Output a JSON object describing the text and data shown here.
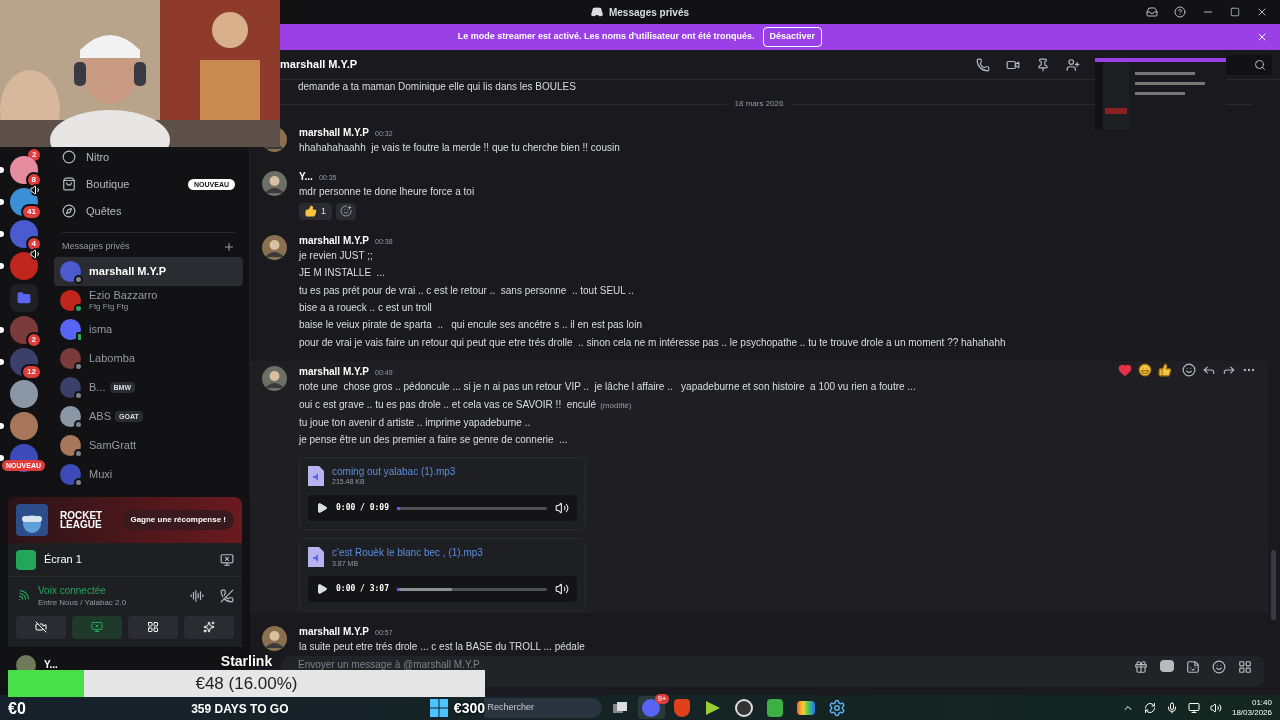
{
  "titlebar": {
    "title": "Messages privés"
  },
  "banner": {
    "text": "Le mode streamer est activé. Les noms d'utilisateur ont été tronqués.",
    "button": "Désactiver"
  },
  "servers": [
    {
      "kind": "badge",
      "badge": "2"
    },
    {
      "kind": "server",
      "badge": "8",
      "unread": true,
      "speaker": false
    },
    {
      "kind": "server",
      "badge": "41",
      "unread": true,
      "speaker": true
    },
    {
      "kind": "server",
      "badge": "4",
      "unread": true,
      "speaker": false
    },
    {
      "kind": "server",
      "unread": true,
      "speaker": true
    },
    {
      "kind": "folder",
      "unread": false,
      "speaker": false
    },
    {
      "kind": "server",
      "badge": "2",
      "unread": true,
      "speaker": false
    },
    {
      "kind": "server",
      "badge": "12",
      "unread": true,
      "speaker": false
    },
    {
      "kind": "server",
      "unread": false,
      "speaker": false
    },
    {
      "kind": "server",
      "unread": true,
      "speaker": false
    },
    {
      "kind": "server",
      "label": "NOUVEAU",
      "unread": true,
      "speaker": false
    }
  ],
  "nav": [
    {
      "kind": "nitro",
      "label": "Nitro"
    },
    {
      "kind": "shop",
      "label": "Boutique",
      "badge": "NOUVEAU"
    },
    {
      "kind": "quests",
      "label": "Quêtes"
    }
  ],
  "dm_section": {
    "title": "Messages privés"
  },
  "dms": [
    {
      "name": "marshall M.Y.P",
      "selected": true,
      "online": false,
      "mobile": false
    },
    {
      "name": "Ezio Bazzarro",
      "selected": false,
      "online": true,
      "mobile": false,
      "activity": "Ftg Ftg Ftg"
    },
    {
      "name": "isma",
      "selected": false,
      "online": true,
      "mobile": true
    },
    {
      "name": "Labomba",
      "selected": false,
      "online": false,
      "mobile": false
    },
    {
      "name": "B...",
      "selected": false,
      "online": false,
      "mobile": false,
      "tag": "BMW"
    },
    {
      "name": "ABS",
      "selected": false,
      "online": false,
      "mobile": false,
      "tag": "GOAT"
    },
    {
      "name": "SamGratt",
      "selected": false,
      "online": false,
      "mobile": false
    },
    {
      "name": "Muxi",
      "selected": false,
      "online": false,
      "mobile": false
    }
  ],
  "promo": {
    "title": "ROCKET LEAGUE",
    "button": "Gagne une récompense !"
  },
  "screen_share": {
    "title": "Écran 1"
  },
  "voice": {
    "status": "Voix connectée",
    "channel": "Entre Nous / Yalabac 2.0"
  },
  "voice_buttons": [
    {
      "kind": "camera-off",
      "selected": false
    },
    {
      "kind": "screen",
      "selected": true
    },
    {
      "kind": "activities",
      "selected": false
    },
    {
      "kind": "soundboard",
      "selected": false
    }
  ],
  "user": {
    "name": "Y..."
  },
  "chat_header": {
    "name": "marshall M.Y.P"
  },
  "messages": [
    {
      "kind": "text",
      "lines": [
        "demande a ta maman Dominique elle qui lis dans les BOULES"
      ]
    },
    {
      "kind": "divider",
      "text": "18 mars 2026"
    },
    {
      "kind": "message",
      "author": "marshall M.Y.P",
      "time": "00:32",
      "hovered": false,
      "lines": [
        "hhahahahaahh  je vais te foutre la merde !! que tu cherche bien !! cousin"
      ]
    },
    {
      "kind": "message",
      "author": "Y...",
      "time": "00:35",
      "hovered": false,
      "lines": [
        "mdr personne te done lheure force a toi"
      ],
      "reactions": [
        {
          "count": "1"
        }
      ]
    },
    {
      "kind": "message",
      "author": "marshall M.Y.P",
      "time": "00:38",
      "hovered": false,
      "lines": [
        "je revien JUST ;;",
        "JE M INSTALLE  ...",
        "tu es pas prét pour de vrai .. c est le retour ..  sans personne  .. tout SEUL ..",
        "bise a a roueck .. c est un troll",
        "baise le veiux pirate de sparta  ..   qui encule ses ancétre s .. il en est pas loin",
        "pour de vrai je vais faire un retour qui peut que etre trés drolle  .. sinon cela ne m intéresse pas .. le psychopathe .. tu te trouve drole a un moment ?? hahahahh"
      ]
    },
    {
      "kind": "message",
      "author": "marshall M.Y.P",
      "time": "00:49",
      "hovered": true,
      "lines": [
        "note une  chose gros .. pédoncule ... si je n ai pas un retour VIP ..  je lâche l affaire ..   yapadeburne et son histoire  a 100 vu rien a foutre ...",
        {
          "text": "oui c est grave .. tu es pas drole .. et cela vas ce SAVOIR !!  enculé",
          "edited": "(modifié)"
        },
        "tu joue ton avenir d artiste .. imprime yapadeburne ..",
        "je pense être un des premier a faire se genre de connerie  ..."
      ],
      "attachments": [
        {
          "name": "coming out yalabac (1).mp3",
          "size": "215.48 KB",
          "time": "0:00 / 0:09",
          "level": 0.02
        },
        {
          "name": "c'est Rouèk le blanc bec , (1).mp3",
          "size": "3.87 MB",
          "time": "0:00 / 3:07",
          "level": 0.37
        }
      ]
    },
    {
      "kind": "message",
      "author": "marshall M.Y.P",
      "time": "00:57",
      "hovered": false,
      "lines": [
        "la suite peut etre trés drole ... c est la BASE du TROLL ... pédale"
      ]
    }
  ],
  "composer": {
    "placeholder": "Envoyer un message à @marshall M.Y.P"
  },
  "goal": {
    "title": "Starlink",
    "level": 0.16,
    "amount": "€48 (16.00%)",
    "start": "€0",
    "countdown": "359 DAYS TO GO",
    "target": "€300"
  },
  "taskbar": {
    "search": "Rechercher",
    "apps": [
      {
        "kind": "chat",
        "badge": "9+",
        "selected": true
      },
      {
        "kind": "browser",
        "selected": false
      },
      {
        "kind": "media",
        "selected": false
      },
      {
        "kind": "record",
        "selected": false
      },
      {
        "kind": "files",
        "selected": false
      },
      {
        "kind": "stack",
        "selected": false
      },
      {
        "kind": "settings",
        "selected": false
      }
    ],
    "time": "01:40",
    "date": "18/03/2026"
  }
}
